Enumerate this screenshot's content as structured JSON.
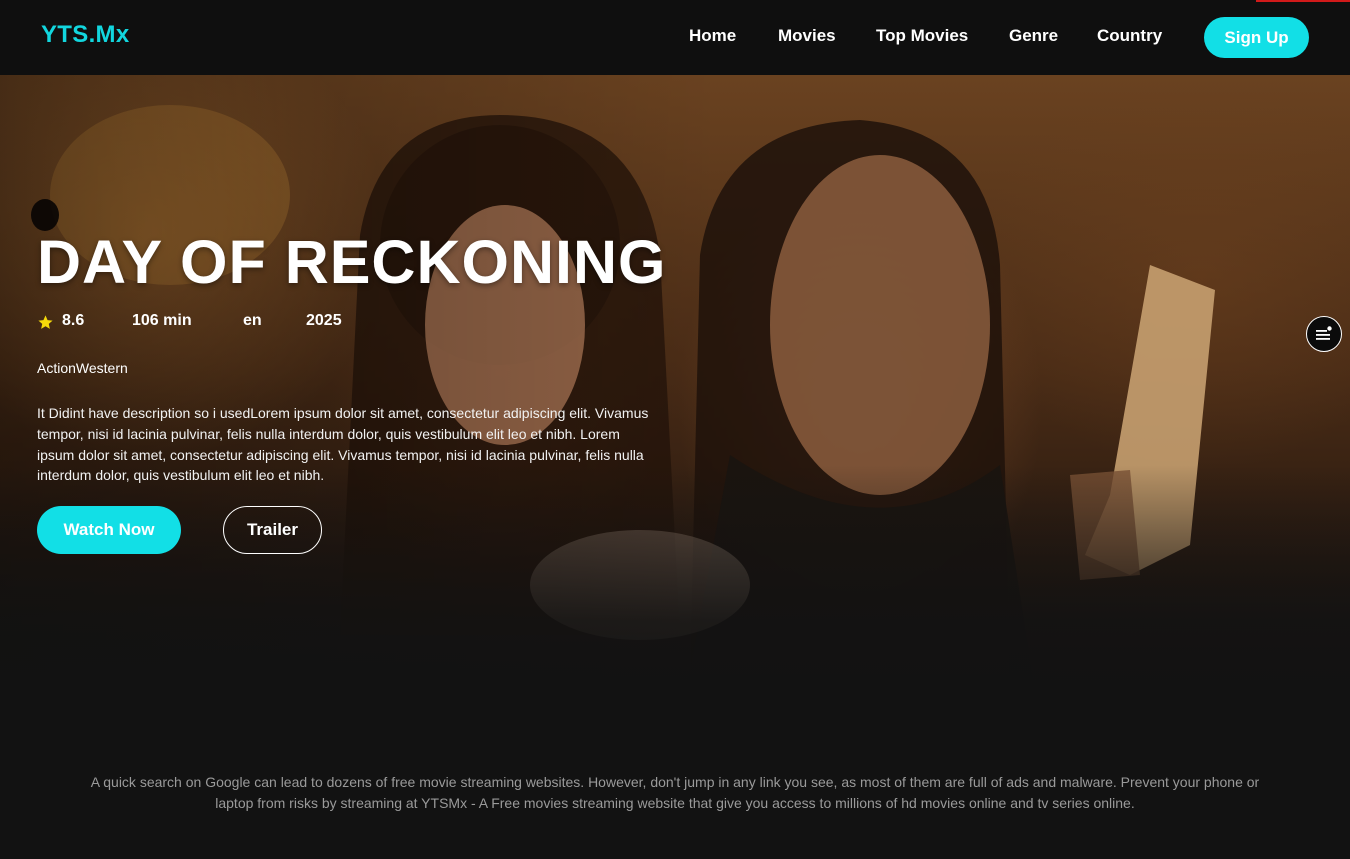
{
  "nav": {
    "logo": "YTS.Mx",
    "links": [
      "Home",
      "Movies",
      "Top Movies",
      "Genre",
      "Country"
    ],
    "signup_label": "Sign Up"
  },
  "hero": {
    "title": "DAY OF RECKONING",
    "rating": "8.6",
    "duration": "106 min",
    "language": "en",
    "year": "2025",
    "genres": "ActionWestern",
    "description": "It Didint have description so i usedLorem ipsum dolor sit amet, consectetur adipiscing elit. Vivamus tempor, nisi id lacinia pulvinar, felis nulla interdum dolor, quis vestibulum elit leo et nibh. Lorem ipsum dolor sit amet, consectetur adipiscing elit. Vivamus tempor, nisi id lacinia pulvinar, felis nulla interdum dolor, quis vestibulum elit leo et nibh.",
    "watch_label": "Watch Now",
    "trailer_label": "Trailer"
  },
  "footer": {
    "note": "A quick search on Google can lead to dozens of free movie streaming websites. However, don't jump in any link you see, as most of them are full of ads and malware. Prevent your phone or laptop from risks by streaming at YTSMx - A Free movies streaming website that give you access to millions of hd movies online and tv series online."
  },
  "colors": {
    "accent": "#12dfe6",
    "star": "#f5d90a",
    "nav_bg": "#0f0f0f",
    "top_right_bar": "#d11a1a"
  },
  "icons": {
    "rating": "star-icon",
    "floating_menu": "menu-list-icon"
  }
}
